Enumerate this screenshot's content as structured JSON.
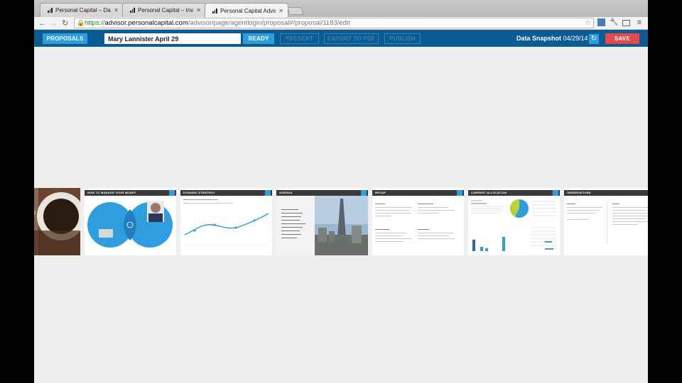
{
  "browser": {
    "tabs": [
      {
        "title": "Personal Capital – Dashbo"
      },
      {
        "title": "Personal Capital – Investm"
      },
      {
        "title": "Personal Capital Advisor"
      }
    ],
    "url": {
      "scheme": "https://",
      "host": "advisor.personalcapital.com",
      "path": "/advisor/page/agentlogin/proposal#/proposal/1183/edit"
    }
  },
  "appbar": {
    "proposals_label": "PROPOSALS",
    "proposal_name": "Mary Lannister April 29",
    "ready_label": "READY",
    "present_label": "PRESENT",
    "export_label": "EXPORT TO PDF",
    "publish_label": "PUBLISH",
    "snapshot_label": "Data Snapshot",
    "snapshot_date": "04/29/14",
    "save_label": "SAVE",
    "colors": {
      "bar": "#0b5c95",
      "accent": "#2e9ede",
      "save": "#e9484a"
    }
  },
  "slides": [
    {
      "title": ""
    },
    {
      "title": "HOW TO MANAGE YOUR MONEY"
    },
    {
      "title": "DYNAMIC STRATEGY"
    },
    {
      "title": "AGENDA"
    },
    {
      "title": "RECAP"
    },
    {
      "title": "CURRENT ALLOCATION"
    },
    {
      "title": "OBSERVATIONS"
    }
  ]
}
